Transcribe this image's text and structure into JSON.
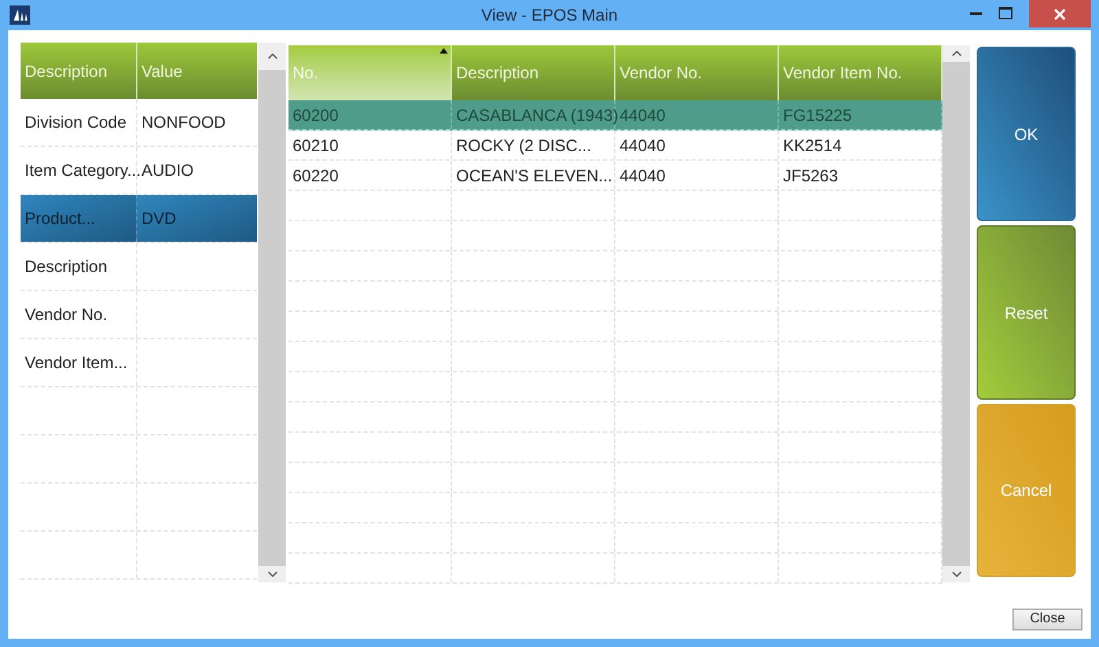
{
  "window": {
    "title": "View - EPOS Main"
  },
  "filter_grid": {
    "columns": [
      "Description",
      "Value"
    ],
    "rows": [
      {
        "cells": [
          "Division Code",
          "NONFOOD"
        ],
        "selected": false
      },
      {
        "cells": [
          "Item Category...",
          "AUDIO"
        ],
        "selected": false
      },
      {
        "cells": [
          "Product...",
          "DVD"
        ],
        "selected": true
      },
      {
        "cells": [
          "Description",
          ""
        ],
        "selected": false
      },
      {
        "cells": [
          "Vendor No.",
          ""
        ],
        "selected": false
      },
      {
        "cells": [
          "Vendor Item...",
          ""
        ],
        "selected": false
      }
    ]
  },
  "item_grid": {
    "columns": [
      {
        "label": "No.",
        "sorted": true
      },
      {
        "label": "Description",
        "sorted": false
      },
      {
        "label": "Vendor No.",
        "sorted": false
      },
      {
        "label": "Vendor Item No.",
        "sorted": false
      }
    ],
    "rows": [
      {
        "cells": [
          "60200",
          "CASABLANCA (1943)",
          "44040",
          "FG15225"
        ],
        "selected": true
      },
      {
        "cells": [
          "60210",
          "ROCKY (2 DISC...",
          "44040",
          "KK2514"
        ],
        "selected": false
      },
      {
        "cells": [
          "60220",
          "OCEAN'S ELEVEN...",
          "44040",
          "JF5263"
        ],
        "selected": false
      }
    ]
  },
  "buttons": [
    {
      "label": "OK",
      "kind": "ok"
    },
    {
      "label": "Reset",
      "kind": "reset"
    },
    {
      "label": "Cancel",
      "kind": "cancel"
    }
  ],
  "close_button": "Close"
}
